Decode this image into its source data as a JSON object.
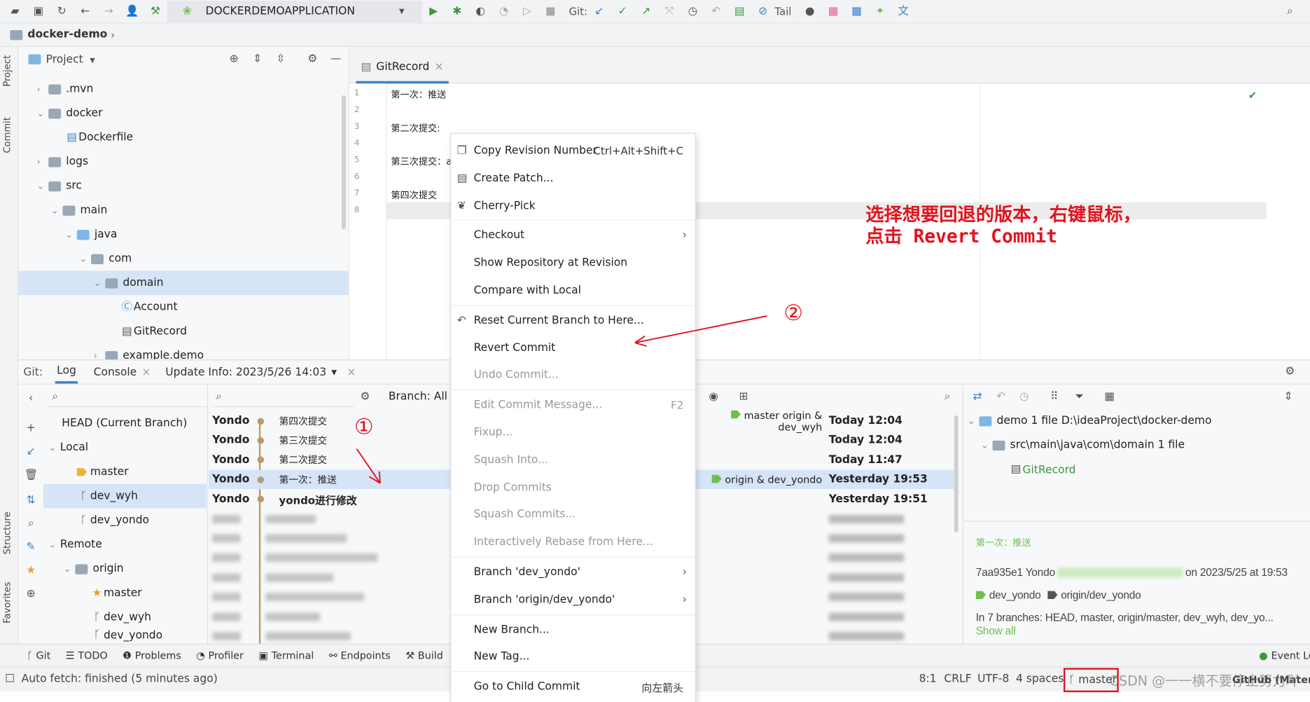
{
  "toolbar": {
    "run_config": "DOCKERDEMOAPPLICATION",
    "git_label": "Git:",
    "tail_label": "Tail"
  },
  "breadcrumb": {
    "project": "docker-demo"
  },
  "stripe": {
    "project": "Project",
    "commit": "Commit",
    "structure": "Structure",
    "favorites": "Favorites"
  },
  "project_panel": {
    "title": "Project",
    "tree": [
      ".mvn",
      "docker",
      "Dockerfile",
      "logs",
      "src",
      "main",
      "java",
      "com",
      "domain",
      "Account",
      "GitRecord",
      "example.demo"
    ]
  },
  "editor": {
    "tab": "GitRecord",
    "lines": [
      "第一次：推送",
      "",
      "第二次提交:",
      "",
      "第三次提交：aa",
      "",
      "第四次提交",
      ""
    ],
    "line_numbers": [
      "1",
      "2",
      "3",
      "4",
      "5",
      "6",
      "7",
      "8"
    ]
  },
  "git": {
    "label": "Git:",
    "tabs": [
      "Log",
      "Console",
      "Update Info: 2023/5/26 14:03"
    ],
    "branch_filter": "Branch: All",
    "branches": {
      "head": "HEAD (Current Branch)",
      "local": "Local",
      "local_items": [
        "master",
        "dev_wyh",
        "dev_yondo"
      ],
      "remote": "Remote",
      "origin": "origin",
      "remote_items": [
        "master",
        "dev_wyh",
        "dev_yondo"
      ]
    },
    "commits": [
      {
        "author": "Yondo",
        "message": "第四次提交",
        "refs": "master  origin & dev_wyh",
        "date": "Today 12:04"
      },
      {
        "author": "Yondo",
        "message": "第三次提交",
        "refs": "",
        "date": "Today 12:04"
      },
      {
        "author": "Yondo",
        "message": "第二次提交",
        "refs": "",
        "date": "Today 11:47"
      },
      {
        "author": "Yondo",
        "message": "第一次：推送",
        "refs": "origin & dev_yondo",
        "date": "Yesterday 19:53"
      },
      {
        "author": "Yondo",
        "message": "yondo进行修改",
        "refs": "",
        "date": "Yesterday 19:51"
      }
    ],
    "changes": {
      "root": "demo  1 file  D:\\ideaProject\\docker-demo",
      "dir": "src\\main\\java\\com\\domain  1 file",
      "file": "GitRecord"
    },
    "details": {
      "subject": "第一次：推送",
      "hash_author": "7aa935e1 Yondo",
      "date": "on 2023/5/25 at 19:53",
      "branch_tags": [
        "dev_yondo",
        "origin/dev_yondo"
      ],
      "branches_text": "In 7 branches: HEAD, master, origin/master, dev_wyh, dev_yo...",
      "show_all": "Show all"
    }
  },
  "context_menu": [
    {
      "label": "Copy Revision Number",
      "shortcut": "Ctrl+Alt+Shift+C",
      "icon": "copy-icon"
    },
    {
      "label": "Create Patch...",
      "icon": "patch-icon"
    },
    {
      "label": "Cherry-Pick",
      "icon": "cherry-icon"
    },
    {
      "label": "Checkout",
      "submenu": true
    },
    {
      "label": "Show Repository at Revision"
    },
    {
      "label": "Compare with Local"
    },
    {
      "label": "Reset Current Branch to Here...",
      "icon": "undo-icon"
    },
    {
      "label": "Revert Commit"
    },
    {
      "label": "Undo Commit...",
      "disabled": true
    },
    {
      "label": "Edit Commit Message...",
      "shortcut": "F2",
      "disabled": true
    },
    {
      "label": "Fixup...",
      "disabled": true
    },
    {
      "label": "Squash Into...",
      "disabled": true
    },
    {
      "label": "Drop Commits",
      "disabled": true
    },
    {
      "label": "Squash Commits...",
      "disabled": true
    },
    {
      "label": "Interactively Rebase from Here...",
      "disabled": true
    },
    {
      "label": "Branch 'dev_yondo'",
      "submenu": true
    },
    {
      "label": "Branch 'origin/dev_yondo'",
      "submenu": true
    },
    {
      "label": "New Branch..."
    },
    {
      "label": "New Tag..."
    },
    {
      "label": "Go to Child Commit",
      "shortcut": "向左箭头"
    }
  ],
  "annotations": {
    "instruction_line1": "选择想要回退的版本，右键鼠标，",
    "instruction_line2": "点击 Revert Commit",
    "step1": "①",
    "step2": "②"
  },
  "tool_windows": [
    "Git",
    "TODO",
    "Problems",
    "Profiler",
    "Terminal",
    "Endpoints",
    "Build",
    "Event Log"
  ],
  "status": {
    "message": "Auto fetch: finished (5 minutes ago)",
    "position": "8:1",
    "line_sep": "CRLF",
    "encoding": "UTF-8",
    "indent": "4 spaces",
    "branch": "master",
    "theme": "GitHub (Material)",
    "watermark": "CSDN @一一横不要停止努力吖"
  },
  "colors": {
    "accent": "#4083c9",
    "selection": "#d5e4f7",
    "annotation": "#e0141e",
    "green": "#6cc14c"
  }
}
